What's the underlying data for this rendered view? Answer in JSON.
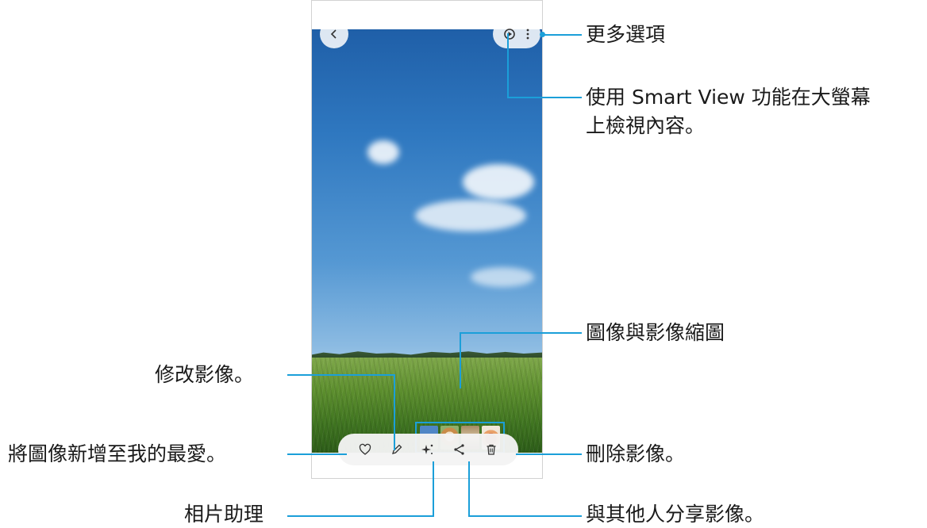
{
  "phone": {
    "back_icon": "chevron-left-icon",
    "cast_icon": "smart-view-icon",
    "more_icon": "more-options-icon",
    "toolbar": [
      "heart-icon",
      "pencil-icon",
      "sparkle-icon",
      "share-icon",
      "trash-icon"
    ]
  },
  "callouts": {
    "more_options": "更多選項",
    "smart_view_line1": "使用 Smart View 功能在大螢幕",
    "smart_view_line2": "上檢視內容。",
    "thumbnails": "圖像與影像縮圖",
    "edit": "修改影像。",
    "favorite": "將圖像新增至我的最愛。",
    "delete": "刪除影像。",
    "assistant": "相片助理",
    "share": "與其他人分享影像。"
  },
  "accent_color": "#1b9fd9"
}
